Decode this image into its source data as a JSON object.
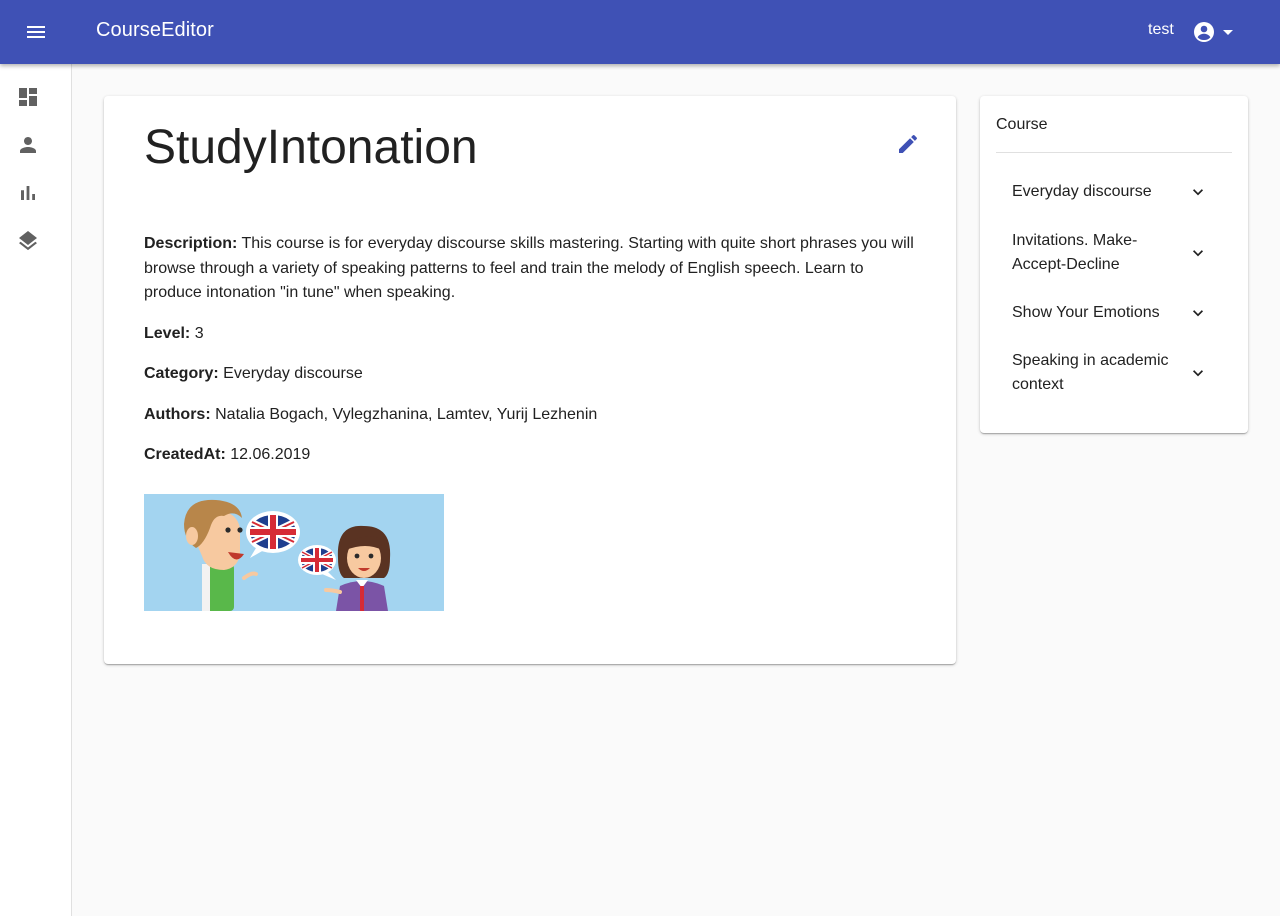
{
  "appbar": {
    "title": "CourseEditor",
    "user": "test",
    "icons": {
      "menu": "menu-icon",
      "account": "account-circle-icon",
      "dropdown": "arrow-drop-down-icon"
    }
  },
  "sidenav": {
    "items": [
      {
        "icon": "dashboard-icon"
      },
      {
        "icon": "person-icon"
      },
      {
        "icon": "bar-chart-icon"
      },
      {
        "icon": "layers-icon"
      }
    ]
  },
  "course": {
    "title": "StudyIntonation",
    "description_label": "Description:",
    "description": "This course is for everyday discourse skills mastering. Starting with quite short phrases you will browse through a variety of speaking patterns to feel and train the melody of English speech. Learn to produce intonation \"in tune\" when speaking.",
    "level_label": "Level:",
    "level": "3",
    "category_label": "Category:",
    "category": "Everyday discourse",
    "authors_label": "Authors:",
    "authors": "Natalia Bogach, Vylegzhanina, Lamtev, Yurij Lezhenin",
    "created_label": "CreatedAt:",
    "created": "12.06.2019",
    "edit_icon": "pencil-icon"
  },
  "side": {
    "heading": "Course",
    "lessons": [
      {
        "label": "Everyday discourse"
      },
      {
        "label": "Invitations. Make-Accept-Decline"
      },
      {
        "label": "Show Your Emotions"
      },
      {
        "label": "Speaking in academic context"
      }
    ]
  },
  "colors": {
    "primary": "#3f51b5",
    "background": "#fafafa",
    "icon_gray": "#616161",
    "image_bg": "#a3d4f0"
  }
}
